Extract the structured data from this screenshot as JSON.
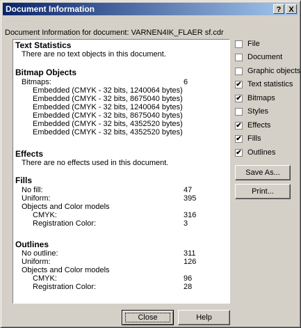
{
  "window": {
    "title": "Document Information",
    "help_glyph": "?",
    "close_glyph": "X",
    "subtitle": "Document Information for document: VARNEN4IK_FLAER sf.cdr"
  },
  "report": {
    "text_statistics": {
      "heading": "Text Statistics",
      "line": "There are no text objects in this document."
    },
    "bitmap_objects": {
      "heading": "Bitmap Objects",
      "bitmaps_label": "Bitmaps:",
      "bitmaps_count": "6",
      "items": [
        "Embedded (CMYK - 32 bits, 1240064 bytes)",
        "Embedded (CMYK - 32 bits, 8675040 bytes)",
        "Embedded (CMYK - 32 bits, 1240064 bytes)",
        "Embedded (CMYK - 32 bits, 8675040 bytes)",
        "Embedded (CMYK - 32 bits, 4352520 bytes)",
        "Embedded (CMYK - 32 bits, 4352520 bytes)"
      ]
    },
    "effects": {
      "heading": "Effects",
      "line": "There are no effects used in this document."
    },
    "fills": {
      "heading": "Fills",
      "no_fill_label": "No fill:",
      "no_fill_value": "47",
      "uniform_label": "Uniform:",
      "uniform_value": "395",
      "models_label": "Objects and Color models",
      "cmyk_label": "CMYK:",
      "cmyk_value": "316",
      "reg_label": "Registration Color:",
      "reg_value": "3"
    },
    "outlines": {
      "heading": "Outlines",
      "no_outline_label": "No outline:",
      "no_outline_value": "311",
      "uniform_label": "Uniform:",
      "uniform_value": "126",
      "models_label": "Objects and Color models",
      "cmyk_label": "CMYK:",
      "cmyk_value": "96",
      "reg_label": "Registration Color:",
      "reg_value": "28"
    }
  },
  "options": [
    {
      "label": "File",
      "checked": false
    },
    {
      "label": "Document",
      "checked": false
    },
    {
      "label": "Graphic objects",
      "checked": false
    },
    {
      "label": "Text statistics",
      "checked": true
    },
    {
      "label": "Bitmaps",
      "checked": true
    },
    {
      "label": "Styles",
      "checked": false
    },
    {
      "label": "Effects",
      "checked": true
    },
    {
      "label": "Fills",
      "checked": true
    },
    {
      "label": "Outlines",
      "checked": true
    }
  ],
  "check_glyph": "✔",
  "buttons": {
    "save_as": "Save As...",
    "print": "Print...",
    "close": "Close",
    "help": "Help"
  }
}
